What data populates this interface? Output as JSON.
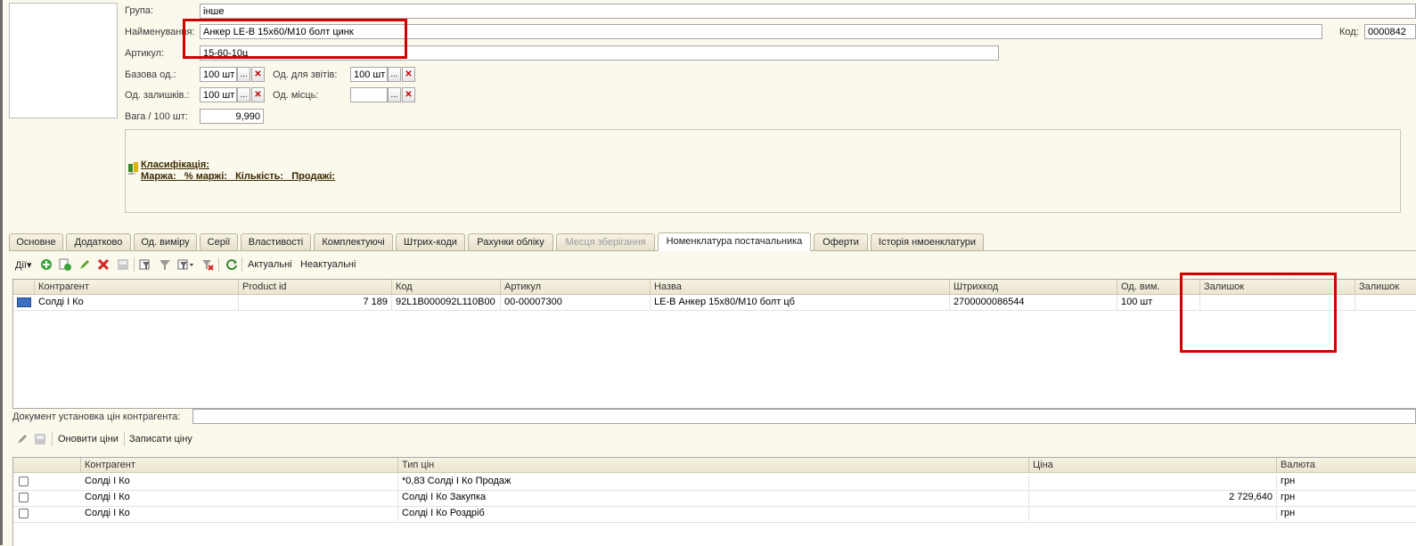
{
  "header": {
    "group_label": "Група:",
    "group_value": "інше",
    "name_label": "Найменування:",
    "name_value": "Анкер LE-B 15х60/М10 болт цинк",
    "code_label": "Код:",
    "code_value": "0000842",
    "article_label": "Артикул:",
    "article_value": "15-60-10ц",
    "base_unit_label": "Базова од.:",
    "base_unit_value": "100 шт",
    "report_unit_label": "Од. для звітів:",
    "report_unit_value": "100 шт",
    "stock_unit_label": "Од. залишків.:",
    "stock_unit_value": "100 шт",
    "place_unit_label": "Од. місць:",
    "place_unit_value": "",
    "weight_label": "Вага / 100 шт:",
    "weight_value": "9,990",
    "dots": "...",
    "clear": "✕"
  },
  "info": {
    "classification": "Класифікація:",
    "margin_line": "Маржа:   % маржі:   Кількість:   Продажі:"
  },
  "tabs": [
    {
      "label": "Основне"
    },
    {
      "label": "Додатково"
    },
    {
      "label": "Од. виміру"
    },
    {
      "label": "Серії"
    },
    {
      "label": "Властивості"
    },
    {
      "label": "Комплектуючі"
    },
    {
      "label": "Штрих-коди"
    },
    {
      "label": "Рахунки обліку"
    },
    {
      "label": "Месця зберігання"
    },
    {
      "label": "Номенклатура постачальника"
    },
    {
      "label": "Оферти"
    },
    {
      "label": "Історія нмоенклатури"
    }
  ],
  "toolbar": {
    "actions_label": "Дії",
    "actual_label": "Актуальні",
    "nonactual_label": "Неактуальні"
  },
  "supplier_grid": {
    "columns": [
      "Контрагент",
      "Product id",
      "Код",
      "Артикул",
      "Назва",
      "Штрихкод",
      "Од. вим.",
      "Залишок",
      "Залишок"
    ],
    "rows": [
      {
        "counterparty": "Солді І Ко",
        "product_id": "7 189",
        "code": "92L1B000092L110B00",
        "article": "00-00007300",
        "name": "LE-B Анкер 15х80/М10 болт цб",
        "barcode": "2700000086544",
        "unit": "100 шт",
        "stock": "",
        "stock2": ""
      }
    ]
  },
  "price_doc": {
    "label": "Документ установка цін контрагента:",
    "value": ""
  },
  "price_toolbar": {
    "refresh_label": "Оновити ціни",
    "save_label": "Записати ціну"
  },
  "price_grid": {
    "columns": [
      "Контрагент",
      "Тип цін",
      "Ціна",
      "Валюта"
    ],
    "rows": [
      {
        "counterparty": "Солді І Ко",
        "price_type": "*0,83 Солді І Ко Продаж",
        "price": "",
        "currency": "грн"
      },
      {
        "counterparty": "Солді І Ко",
        "price_type": "Солді І Ко Закупка",
        "price": "2 729,640",
        "currency": "грн"
      },
      {
        "counterparty": "Солді І Ко",
        "price_type": "Солді І Ко Роздріб",
        "price": "",
        "currency": "грн"
      }
    ]
  },
  "colors": {
    "background": "#FBF8EC",
    "highlight": "#d10000",
    "grid_header": "#ebe5d0"
  }
}
